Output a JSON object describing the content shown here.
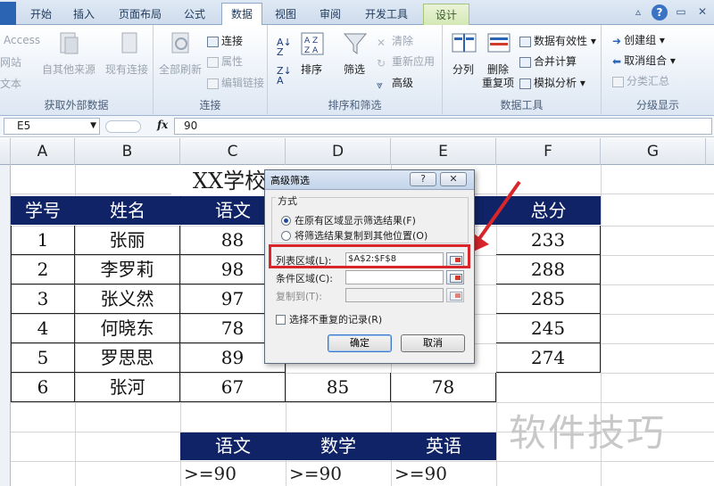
{
  "ribbon": {
    "tabs": [
      {
        "label": "开始"
      },
      {
        "label": "插入"
      },
      {
        "label": "页面布局"
      },
      {
        "label": "公式"
      },
      {
        "label": "数据"
      },
      {
        "label": "视图"
      },
      {
        "label": "审阅"
      },
      {
        "label": "开发工具"
      },
      {
        "label": "设计"
      }
    ],
    "active_tab": "数据",
    "groups": {
      "external": {
        "name": "获取外部数据",
        "access": "Access",
        "web": "网站",
        "text": "文本",
        "other_sources": "自其他来源",
        "existing": "现有连接"
      },
      "connections": {
        "name": "连接",
        "refresh_all": "全部刷新",
        "connections": "连接",
        "properties": "属性",
        "edit_links": "编辑链接"
      },
      "sort_filter": {
        "name": "排序和筛选",
        "sort": "排序",
        "filter": "筛选",
        "clear": "清除",
        "reapply": "重新应用",
        "advanced": "高级"
      },
      "data_tools": {
        "name": "数据工具",
        "split": "分列",
        "remove_dup_line1": "删除",
        "remove_dup_line2": "重复项",
        "validation": "数据有效性",
        "consolidate": "合并计算",
        "whatif": "模拟分析"
      },
      "outline": {
        "name": "分级显示",
        "group": "创建组",
        "ungroup": "取消组合",
        "subtotal": "分类汇总"
      }
    }
  },
  "formula_bar": {
    "name_box": "E5",
    "fx": "fx",
    "value": "90"
  },
  "columns": [
    "A",
    "B",
    "C",
    "D",
    "E",
    "F",
    "G"
  ],
  "sheet": {
    "title_visible": "XX学校",
    "headers": [
      "学号",
      "姓名",
      "语文",
      "",
      "",
      "总分"
    ],
    "rows": [
      {
        "id": "1",
        "name": "张丽",
        "chinese": "88",
        "total": "233"
      },
      {
        "id": "2",
        "name": "李罗莉",
        "chinese": "98",
        "total": "288"
      },
      {
        "id": "3",
        "name": "张义然",
        "chinese": "97",
        "total": "285"
      },
      {
        "id": "4",
        "name": "何晓东",
        "chinese": "78",
        "total": "245"
      },
      {
        "id": "5",
        "name": "罗思思",
        "chinese": "89",
        "total": "274"
      },
      {
        "id": "6",
        "name": "张河",
        "chinese": "67",
        "math": "85",
        "english": "78"
      }
    ],
    "criteria_headers": [
      "语文",
      "数学",
      "英语"
    ],
    "criteria_values": [
      ">=90",
      ">=90",
      ">=90"
    ]
  },
  "dialog": {
    "title": "高级筛选",
    "help_btn": "?",
    "close_btn": "✕",
    "method_label": "方式",
    "option_inplace": "在原有区域显示筛选结果(F)",
    "option_copy": "将筛选结果复制到其他位置(O)",
    "list_range_label": "列表区域(L):",
    "list_range_value": "$A$2:$F$8",
    "criteria_range_label": "条件区域(C):",
    "criteria_range_value": "",
    "copy_to_label": "复制到(T):",
    "copy_to_value": "",
    "unique_label": "选择不重复的记录(R)",
    "ok": "确定",
    "cancel": "取消"
  },
  "watermark": "软件技巧",
  "colors": {
    "header_fill": "#0f2366",
    "highlight": "#d8262b",
    "tab_text": "#1e395b"
  }
}
